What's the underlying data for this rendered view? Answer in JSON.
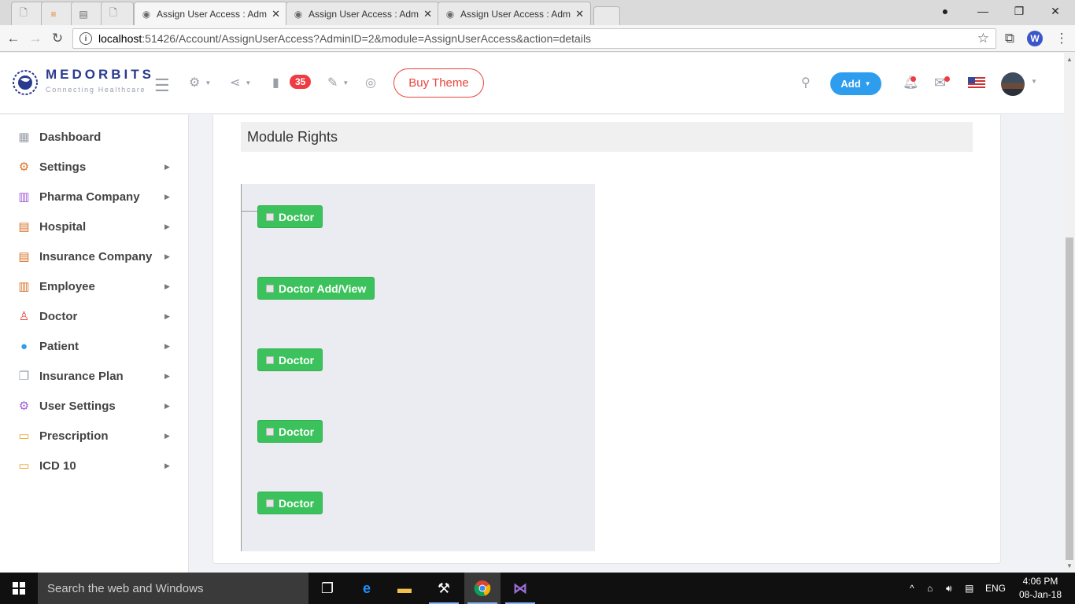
{
  "browser": {
    "tabs": [
      {
        "title": "",
        "icon": "page-icon"
      },
      {
        "title": "",
        "icon": "stackoverflow-icon"
      },
      {
        "title": "",
        "icon": "doc-icon"
      },
      {
        "title": "",
        "icon": "page-icon"
      },
      {
        "title": "Assign User Access : Adm",
        "icon": "medorbits-favicon"
      },
      {
        "title": "Assign User Access : Adm",
        "icon": "medorbits-favicon"
      },
      {
        "title": "Assign User Access : Adm",
        "icon": "medorbits-favicon"
      }
    ],
    "url_host": "localhost",
    "url_path": ":51426/Account/AssignUserAccess?AdminID=2&module=AssignUserAccess&action=details",
    "profile_initial": "W"
  },
  "header": {
    "logo_name": "MEDORBITS",
    "logo_tagline": "Connecting Healthcare",
    "docs_badge": "35",
    "buy_theme": "Buy Theme",
    "add_label": "Add"
  },
  "sidebar": {
    "items": [
      {
        "label": "Dashboard",
        "icon": "dashboard-icon",
        "color": "#9aa0a8",
        "has_arrow": false
      },
      {
        "label": "Settings",
        "icon": "gear-icon",
        "color": "#d9742b",
        "has_arrow": true
      },
      {
        "label": "Pharma Company",
        "icon": "building-icon",
        "color": "#a15bd9",
        "has_arrow": true
      },
      {
        "label": "Hospital",
        "icon": "hospital-icon",
        "color": "#d9742b",
        "has_arrow": true
      },
      {
        "label": "Insurance Company",
        "icon": "hospital-icon",
        "color": "#d9742b",
        "has_arrow": true
      },
      {
        "label": "Employee",
        "icon": "building-icon",
        "color": "#d9742b",
        "has_arrow": true
      },
      {
        "label": "Doctor",
        "icon": "doctor-icon",
        "color": "#e8453c",
        "has_arrow": true
      },
      {
        "label": "Patient",
        "icon": "user-icon",
        "color": "#2f9ded",
        "has_arrow": true
      },
      {
        "label": "Insurance Plan",
        "icon": "files-icon",
        "color": "#9aa0a8",
        "has_arrow": true
      },
      {
        "label": "User Settings",
        "icon": "gear-icon",
        "color": "#a15bd9",
        "has_arrow": true
      },
      {
        "label": "Prescription",
        "icon": "prescription-icon",
        "color": "#f0a030",
        "has_arrow": true
      },
      {
        "label": "ICD 10",
        "icon": "prescription-icon",
        "color": "#f0a030",
        "has_arrow": true
      }
    ]
  },
  "main": {
    "title": "Module Rights",
    "tree_nodes": [
      {
        "label": "Doctor",
        "checked": false
      },
      {
        "label": "Doctor Add/View",
        "checked": false
      },
      {
        "label": "Doctor",
        "checked": false
      },
      {
        "label": "Doctor",
        "checked": false
      },
      {
        "label": "Doctor",
        "checked": false
      }
    ]
  },
  "taskbar": {
    "search_placeholder": "Search the web and Windows",
    "language": "ENG",
    "time": "4:06 PM",
    "date": "08-Jan-18"
  },
  "colors": {
    "accent_green": "#3cc25c",
    "accent_blue": "#2f9ded",
    "accent_red": "#e8453c"
  }
}
